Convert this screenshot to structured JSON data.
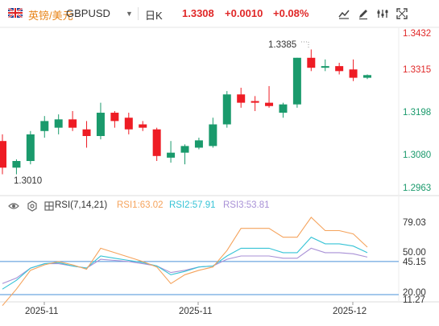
{
  "header": {
    "pair_name": "英镑/美元",
    "pair_code": "GBPUSD",
    "period": "日K",
    "price": "1.3308",
    "change": "+0.0010",
    "change_pct": "+0.08%",
    "icons": [
      "line-draw-icon",
      "pencil-icon",
      "settings-icon",
      "fullscreen-icon"
    ]
  },
  "price_axis": [
    "1.3432",
    "1.3315",
    "1.3198",
    "1.3080",
    "1.2963"
  ],
  "annotations": {
    "high": "1.3385",
    "low": "1.3010"
  },
  "rsi": {
    "label": "RSI(7,14,21)",
    "rsi1": "RSI1:63.02",
    "rsi2": "RSI2:57.91",
    "rsi3": "RSI3:53.81",
    "axis": [
      "79.03",
      "50.00",
      "45.15",
      "20.00",
      "11.27"
    ]
  },
  "dates": [
    "2025-11",
    "2025-11",
    "2025-12"
  ],
  "colors": {
    "up": "#1a9a6c",
    "down": "#ee1c24",
    "rsi1": "#f5a35c",
    "rsi2": "#36c3d6",
    "rsi3": "#a890d6",
    "accent": "#e8851a"
  },
  "chart_data": {
    "type": "candlestick",
    "ylim": [
      1.2963,
      1.3432
    ],
    "candles": [
      {
        "o": 1.311,
        "h": 1.313,
        "l": 1.301,
        "c": 1.303
      },
      {
        "o": 1.303,
        "h": 1.3055,
        "l": 1.301,
        "c": 1.305
      },
      {
        "o": 1.305,
        "h": 1.314,
        "l": 1.304,
        "c": 1.313
      },
      {
        "o": 1.314,
        "h": 1.3185,
        "l": 1.312,
        "c": 1.317
      },
      {
        "o": 1.315,
        "h": 1.319,
        "l": 1.313,
        "c": 1.3175
      },
      {
        "o": 1.3175,
        "h": 1.32,
        "l": 1.314,
        "c": 1.315
      },
      {
        "o": 1.3145,
        "h": 1.317,
        "l": 1.309,
        "c": 1.3125
      },
      {
        "o": 1.3125,
        "h": 1.3225,
        "l": 1.3115,
        "c": 1.3195
      },
      {
        "o": 1.3195,
        "h": 1.32,
        "l": 1.315,
        "c": 1.317
      },
      {
        "o": 1.318,
        "h": 1.3195,
        "l": 1.313,
        "c": 1.3145
      },
      {
        "o": 1.316,
        "h": 1.317,
        "l": 1.314,
        "c": 1.315
      },
      {
        "o": 1.3145,
        "h": 1.315,
        "l": 1.305,
        "c": 1.3065
      },
      {
        "o": 1.306,
        "h": 1.311,
        "l": 1.3045,
        "c": 1.3075
      },
      {
        "o": 1.3075,
        "h": 1.31,
        "l": 1.304,
        "c": 1.3095
      },
      {
        "o": 1.309,
        "h": 1.312,
        "l": 1.3085,
        "c": 1.3112
      },
      {
        "o": 1.3095,
        "h": 1.318,
        "l": 1.309,
        "c": 1.316
      },
      {
        "o": 1.316,
        "h": 1.326,
        "l": 1.315,
        "c": 1.325
      },
      {
        "o": 1.325,
        "h": 1.327,
        "l": 1.321,
        "c": 1.3225
      },
      {
        "o": 1.323,
        "h": 1.3245,
        "l": 1.32,
        "c": 1.3225
      },
      {
        "o": 1.3225,
        "h": 1.3275,
        "l": 1.321,
        "c": 1.3215
      },
      {
        "o": 1.3195,
        "h": 1.3225,
        "l": 1.318,
        "c": 1.322
      },
      {
        "o": 1.322,
        "h": 1.336,
        "l": 1.321,
        "c": 1.336
      },
      {
        "o": 1.336,
        "h": 1.3385,
        "l": 1.332,
        "c": 1.333
      },
      {
        "o": 1.333,
        "h": 1.3355,
        "l": 1.332,
        "c": 1.3335
      },
      {
        "o": 1.3335,
        "h": 1.3345,
        "l": 1.331,
        "c": 1.332
      },
      {
        "o": 1.3325,
        "h": 1.3355,
        "l": 1.329,
        "c": 1.33
      },
      {
        "o": 1.33,
        "h": 1.331,
        "l": 1.3296,
        "c": 1.3308
      }
    ],
    "rsi": {
      "ylim": [
        11.27,
        90
      ],
      "rsi1": [
        10,
        25,
        42,
        47,
        50,
        47,
        43,
        62,
        58,
        54,
        50,
        45,
        30,
        38,
        42,
        45,
        60,
        80,
        80,
        80,
        72,
        72,
        90,
        78,
        78,
        75,
        63
      ],
      "rsi2": [
        25,
        33,
        44,
        48,
        49,
        46,
        44,
        55,
        53,
        51,
        49,
        46,
        38,
        41,
        45,
        46,
        55,
        62,
        62,
        62,
        58,
        58,
        72,
        66,
        66,
        64,
        58
      ],
      "rsi3": [
        30,
        35,
        44,
        48,
        48,
        46,
        44,
        52,
        51,
        50,
        48,
        46,
        40,
        42,
        45,
        46,
        52,
        55,
        55,
        55,
        53,
        53,
        62,
        58,
        58,
        57,
        54
      ]
    }
  }
}
